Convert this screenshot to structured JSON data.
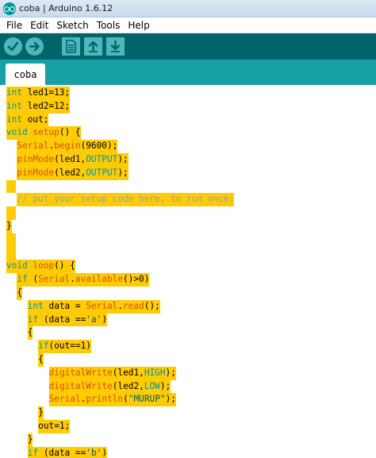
{
  "window": {
    "title": "coba | Arduino 1.6.12"
  },
  "menu": [
    "File",
    "Edit",
    "Sketch",
    "Tools",
    "Help"
  ],
  "toolbar": {
    "buttons": [
      "verify-icon",
      "upload-icon",
      "new-icon",
      "open-icon",
      "save-icon"
    ]
  },
  "tabs": [
    {
      "label": "coba",
      "active": true
    }
  ],
  "editor": {
    "lines": [
      {
        "indent": "",
        "tokens": [
          [
            "kw",
            "int"
          ],
          [
            "",
            " led1=13;"
          ]
        ]
      },
      {
        "indent": "",
        "tokens": [
          [
            "kw",
            "int"
          ],
          [
            "",
            " led2=12;"
          ]
        ]
      },
      {
        "indent": "",
        "tokens": [
          [
            "kw",
            "int"
          ],
          [
            "",
            " out;"
          ]
        ]
      },
      {
        "indent": "",
        "tokens": [
          [
            "kw",
            "void"
          ],
          [
            "",
            " "
          ],
          [
            "fn",
            "setup"
          ],
          [
            "",
            "() {"
          ]
        ]
      },
      {
        "indent": "  ",
        "tokens": [
          [
            "fn",
            "Serial"
          ],
          [
            "",
            "."
          ],
          [
            "fn",
            "begin"
          ],
          [
            "",
            "(9600);"
          ]
        ]
      },
      {
        "indent": "  ",
        "tokens": [
          [
            "fn",
            "pinMode"
          ],
          [
            "",
            "(led1,"
          ],
          [
            "cst",
            "OUTPUT"
          ],
          [
            "",
            ");"
          ]
        ]
      },
      {
        "indent": "  ",
        "tokens": [
          [
            "fn",
            "pinMode"
          ],
          [
            "",
            "(led2,"
          ],
          [
            "cst",
            "OUTPUT"
          ],
          [
            "",
            ");"
          ]
        ]
      },
      {
        "indent": "",
        "tokens": []
      },
      {
        "indent": "  ",
        "tokens": [
          [
            "cm",
            "// put your setup code here, to run once:"
          ]
        ]
      },
      {
        "indent": "",
        "tokens": []
      },
      {
        "indent": "",
        "tokens": [
          [
            "",
            "}"
          ]
        ]
      },
      {
        "indent": "",
        "tokens": []
      },
      {
        "indent": "",
        "tokens": []
      },
      {
        "indent": "",
        "tokens": [
          [
            "kw",
            "void"
          ],
          [
            "",
            " "
          ],
          [
            "fn",
            "loop"
          ],
          [
            "",
            "() {"
          ]
        ]
      },
      {
        "indent": "  ",
        "tokens": [
          [
            "kw",
            "if"
          ],
          [
            "",
            " ("
          ],
          [
            "fn",
            "Serial"
          ],
          [
            "",
            "."
          ],
          [
            "fn",
            "available"
          ],
          [
            "",
            "()>0)"
          ]
        ]
      },
      {
        "indent": "  ",
        "tokens": [
          [
            "",
            "{"
          ]
        ]
      },
      {
        "indent": "    ",
        "tokens": [
          [
            "kw",
            "int"
          ],
          [
            "",
            " data = "
          ],
          [
            "fn",
            "Serial"
          ],
          [
            "",
            "."
          ],
          [
            "fn",
            "read"
          ],
          [
            "",
            "();"
          ]
        ]
      },
      {
        "indent": "    ",
        "tokens": [
          [
            "kw",
            "if"
          ],
          [
            "",
            " (data =="
          ],
          [
            "str",
            "'a'"
          ],
          [
            "",
            ")"
          ]
        ]
      },
      {
        "indent": "    ",
        "tokens": [
          [
            "",
            "{"
          ]
        ]
      },
      {
        "indent": "      ",
        "tokens": [
          [
            "kw",
            "if"
          ],
          [
            "",
            "(out==1)"
          ]
        ]
      },
      {
        "indent": "      ",
        "tokens": [
          [
            "",
            "{"
          ]
        ]
      },
      {
        "indent": "        ",
        "tokens": [
          [
            "fn",
            "digitalWrite"
          ],
          [
            "",
            "(led1,"
          ],
          [
            "cst",
            "HIGH"
          ],
          [
            "",
            ");"
          ]
        ]
      },
      {
        "indent": "        ",
        "tokens": [
          [
            "fn",
            "digitalWrite"
          ],
          [
            "",
            "(led2,"
          ],
          [
            "cst",
            "LOW"
          ],
          [
            "",
            ");"
          ]
        ]
      },
      {
        "indent": "        ",
        "tokens": [
          [
            "fn",
            "Serial"
          ],
          [
            "",
            "."
          ],
          [
            "fn",
            "println"
          ],
          [
            "",
            "("
          ],
          [
            "str",
            "\"MURUP\""
          ],
          [
            "",
            ");"
          ]
        ]
      },
      {
        "indent": "      ",
        "tokens": [
          [
            "",
            "}"
          ]
        ]
      },
      {
        "indent": "      ",
        "tokens": [
          [
            "",
            "out=1;"
          ]
        ]
      },
      {
        "indent": "    ",
        "tokens": [
          [
            "",
            "}"
          ]
        ]
      },
      {
        "indent": "    ",
        "tokens": [
          [
            "kw",
            "if"
          ],
          [
            "",
            " (data =="
          ],
          [
            "str",
            "'b'"
          ],
          [
            "",
            ")"
          ]
        ]
      }
    ]
  }
}
